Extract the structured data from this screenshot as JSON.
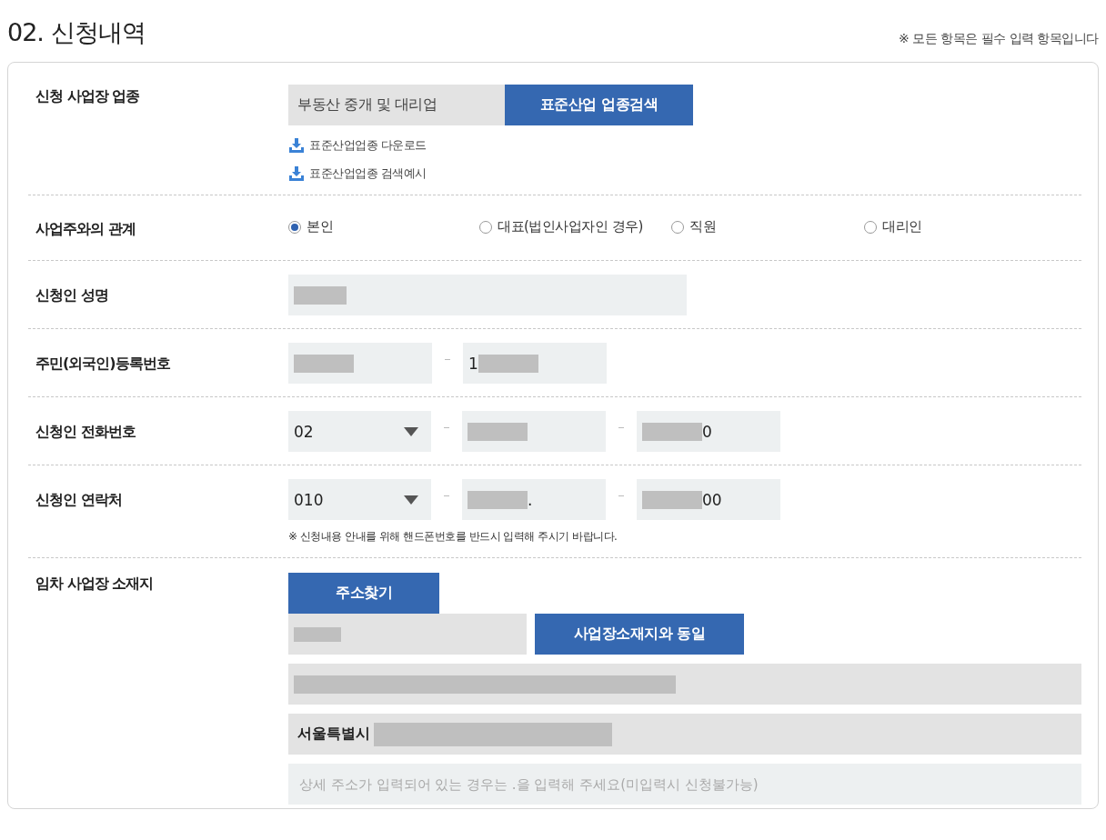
{
  "heading": "02. 신청내역",
  "required_note": "※ 모든 항목은 필수 입력 항목입니다",
  "rows": [
    {
      "kind": "industry",
      "label": "신청 사업장 업종",
      "value": "부동산 중개 및 대리업",
      "button": "표준산업 업종검색",
      "links": [
        "표준산업업종 다운로드",
        "표준산업업종 검색예시"
      ]
    },
    {
      "kind": "radio",
      "label": "사업주와의 관계",
      "options": [
        {
          "label": "본인",
          "selected": true
        },
        {
          "label": "대표(법인사업자인 경우)",
          "selected": false
        },
        {
          "label": "직원",
          "selected": false
        },
        {
          "label": "대리인",
          "selected": false
        }
      ]
    },
    {
      "kind": "wide",
      "label": "신청인 성명",
      "parts": [
        {
          "kind": "input",
          "redacted": true
        }
      ]
    },
    {
      "kind": "split",
      "label": "주민(외국인)등록번호",
      "parts": [
        {
          "kind": "input",
          "redacted": true
        },
        {
          "kind": "input",
          "value": "1",
          "redacted": true,
          "value_first": true
        }
      ]
    },
    {
      "kind": "split",
      "label": "신청인 전화번호",
      "parts": [
        {
          "kind": "select",
          "value": "02"
        },
        {
          "kind": "input",
          "redacted": true
        },
        {
          "kind": "input",
          "value": "0",
          "redacted": true
        }
      ]
    },
    {
      "kind": "split",
      "label": "신청인 연락처",
      "parts": [
        {
          "kind": "select",
          "value": "010"
        },
        {
          "kind": "input",
          "value": ".",
          "redacted": true
        },
        {
          "kind": "input",
          "value": "00",
          "redacted": true
        }
      ],
      "note": "※ 신청내용 안내를 위해 핸드폰번호를 반드시 입력해 주시기 바랍니다."
    },
    {
      "kind": "address",
      "label": "임차 사업장 소재지",
      "search_button": "주소찾기",
      "postcode": {
        "redacted": true
      },
      "same_button": "사업장소재지와 동일",
      "address1": {
        "redacted": true
      },
      "address2": {
        "value": "서울특별시",
        "redacted": true,
        "value_first": true
      },
      "detail": {
        "placeholder": "상세 주소가 입력되어 있는 경우는 .을 입력해 주세요(미입력시 신청불가능)"
      }
    }
  ]
}
